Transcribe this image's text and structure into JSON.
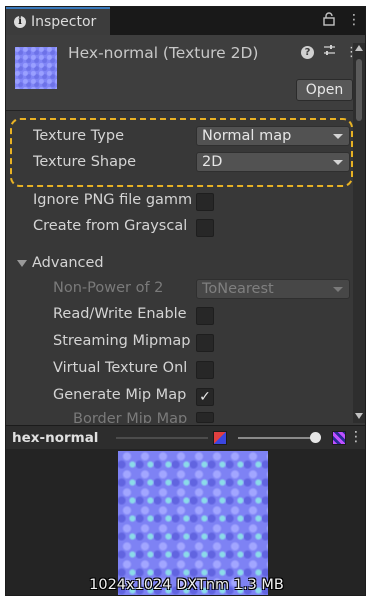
{
  "tab": {
    "title": "Inspector",
    "lock_icon": "lock-icon",
    "menu_icon": "kebab-menu-icon"
  },
  "header": {
    "asset_title": "Hex-normal (Texture 2D)",
    "open_label": "Open",
    "icons": [
      "help-icon",
      "preset-icon",
      "kebab-menu-icon"
    ]
  },
  "fields": {
    "texture_type": {
      "label": "Texture Type",
      "value": "Normal map"
    },
    "texture_shape": {
      "label": "Texture Shape",
      "value": "2D"
    },
    "ignore_png_gamma": {
      "label": "Ignore PNG file gamm",
      "checked": false
    },
    "create_from_grayscale": {
      "label": "Create from Grayscal",
      "checked": false
    },
    "advanced": {
      "label": "Advanced",
      "expanded": true
    },
    "non_power_of_2": {
      "label": "Non-Power of 2",
      "value": "ToNearest",
      "disabled": true
    },
    "read_write": {
      "label": "Read/Write Enable",
      "checked": false
    },
    "streaming_mipmaps": {
      "label": "Streaming Mipmap",
      "checked": false
    },
    "virtual_texture_only": {
      "label": "Virtual Texture Onl",
      "checked": false
    },
    "generate_mip_maps": {
      "label": "Generate Mip Map",
      "checked": true,
      "check_glyph": "✓"
    },
    "border_mip_maps": {
      "label": "Border Mip Map",
      "checked": false
    }
  },
  "preview": {
    "title": "hex-normal",
    "info": "1024x1024  DXTnm  1.3 MB",
    "menu_glyph": "⋮"
  },
  "colors": {
    "accent_tab": "#3a79bb",
    "highlight": "#e8b224",
    "normal_map": "#7e82f4"
  }
}
